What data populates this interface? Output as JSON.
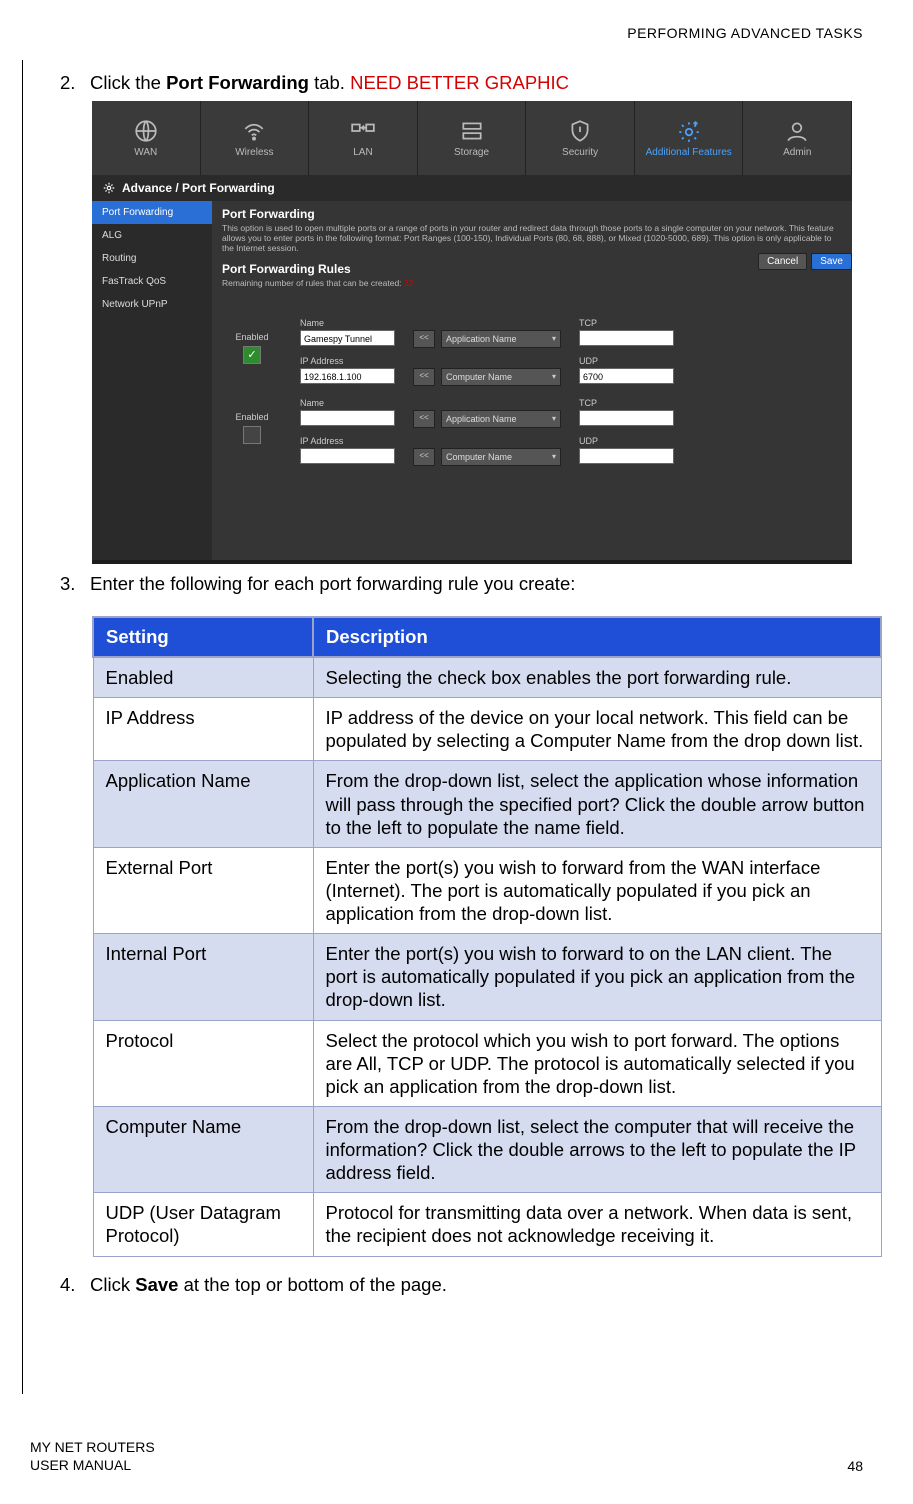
{
  "header": {
    "right": "PERFORMING ADVANCED TASKS"
  },
  "steps": {
    "s2": {
      "num": "2.",
      "prefix": "Click the ",
      "bold": "Port Forwarding",
      "mid": " tab. ",
      "red": "NEED BETTER GRAPHIC"
    },
    "s3": {
      "num": "3.",
      "text": "Enter the following for each port forwarding rule you create:"
    },
    "s4": {
      "num": "4.",
      "prefix": "Click ",
      "bold": "Save",
      "suffix": " at the top or bottom of the page."
    }
  },
  "screenshot": {
    "tabs": {
      "wan": "WAN",
      "wireless": "Wireless",
      "lan": "LAN",
      "storage": "Storage",
      "security": "Security",
      "additional": "Additional Features",
      "admin": "Admin"
    },
    "breadcrumb": "Advance / Port Forwarding",
    "side": {
      "pf": "Port Forwarding",
      "alg": "ALG",
      "routing": "Routing",
      "qos": "FasTrack QoS",
      "upnp": "Network UPnP"
    },
    "main": {
      "title": "Port Forwarding",
      "desc": "This option is used to open multiple ports or a range of ports in your router and redirect data through those ports to a single computer on your network. This feature allows you to enter ports in the following format: Port Ranges (100-150), Individual Ports (80, 68, 888), or Mixed (1020-5000, 689). This option is only applicable to the Internet session.",
      "rules_title": "Port Forwarding Rules",
      "remaining": "Remaining number of rules that can be created: ",
      "remaining_num": "32",
      "cancel": "Cancel",
      "save": "Save",
      "enabled_label": "Enabled",
      "name_label": "Name",
      "ip_label": "IP Address",
      "app_dd": "Application Name",
      "comp_dd": "Computer Name",
      "tcp_label": "TCP",
      "udp_label": "UDP",
      "rule1": {
        "name": "Gamespy Tunnel",
        "ip": "192.168.1.100",
        "udp": "6700"
      }
    }
  },
  "table": {
    "head": {
      "setting": "Setting",
      "desc": "Description"
    },
    "rows": {
      "enabled": {
        "s": "Enabled",
        "d": "Selecting the check box enables the port forwarding rule."
      },
      "ip": {
        "s": "IP Address",
        "d": "IP address of the device on your local network. This field can be populated by selecting a Computer Name from the drop down list."
      },
      "app": {
        "s": "Application Name",
        "d": "From the drop-down list, select the application whose information will pass through the specified port? Click the double arrow button to the left to populate the name field."
      },
      "ext": {
        "s": "External Port",
        "d": "Enter the port(s) you wish to forward from the WAN interface (Internet). The port is automatically populated if you pick an application from the drop-down list."
      },
      "int": {
        "s": "Internal Port",
        "d": "Enter the port(s) you wish to forward to on the LAN client. The port is automatically populated if you pick an application from the drop-down list."
      },
      "proto": {
        "s": "Protocol",
        "d": "Select the protocol which you wish to port forward. The options are All, TCP or UDP. The protocol is automatically selected if you pick an application from the drop-down list."
      },
      "comp": {
        "s": "Computer Name",
        "d": "From the drop-down list, select the computer that will receive the information? Click the double arrows to the left to populate the IP address field."
      },
      "udp": {
        "s": "UDP (User Datagram Protocol)",
        "d": "Protocol for transmitting data over a network. When data is sent, the recipient does not acknowledge receiving it."
      }
    }
  },
  "footer": {
    "line1": "MY NET ROUTERS",
    "line2": "USER MANUAL",
    "page": "48"
  }
}
